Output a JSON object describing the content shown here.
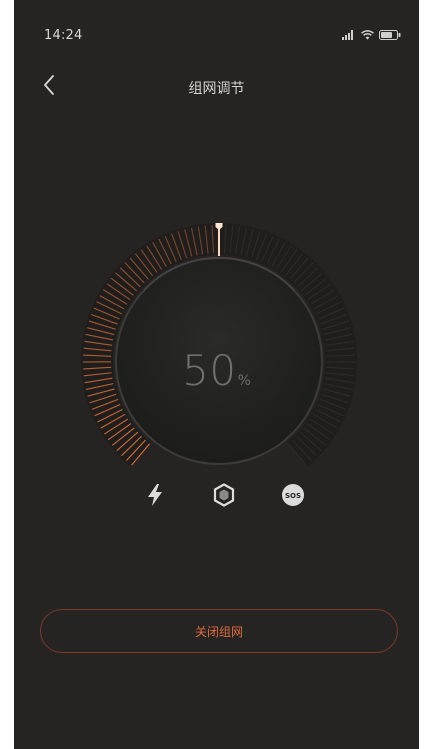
{
  "status_bar": {
    "time": "14:24",
    "icons": [
      "signal-icon",
      "wifi-icon",
      "battery-icon"
    ]
  },
  "nav": {
    "back_icon": "chevron-left-icon",
    "title": "组网调节"
  },
  "dial": {
    "value": 50,
    "display_value": "50",
    "unit": "%",
    "accent_color": "#e2733a",
    "track_color": "#2e2d2b"
  },
  "modes": [
    {
      "name": "lightning-mode",
      "icon": "lightning-icon"
    },
    {
      "name": "network-mode",
      "icon": "hexagon-icon"
    },
    {
      "name": "sos-mode",
      "icon": "sos-icon",
      "label": "SOS"
    }
  ],
  "action_button": {
    "label": "关闭组网",
    "color": "#e06a3c"
  }
}
